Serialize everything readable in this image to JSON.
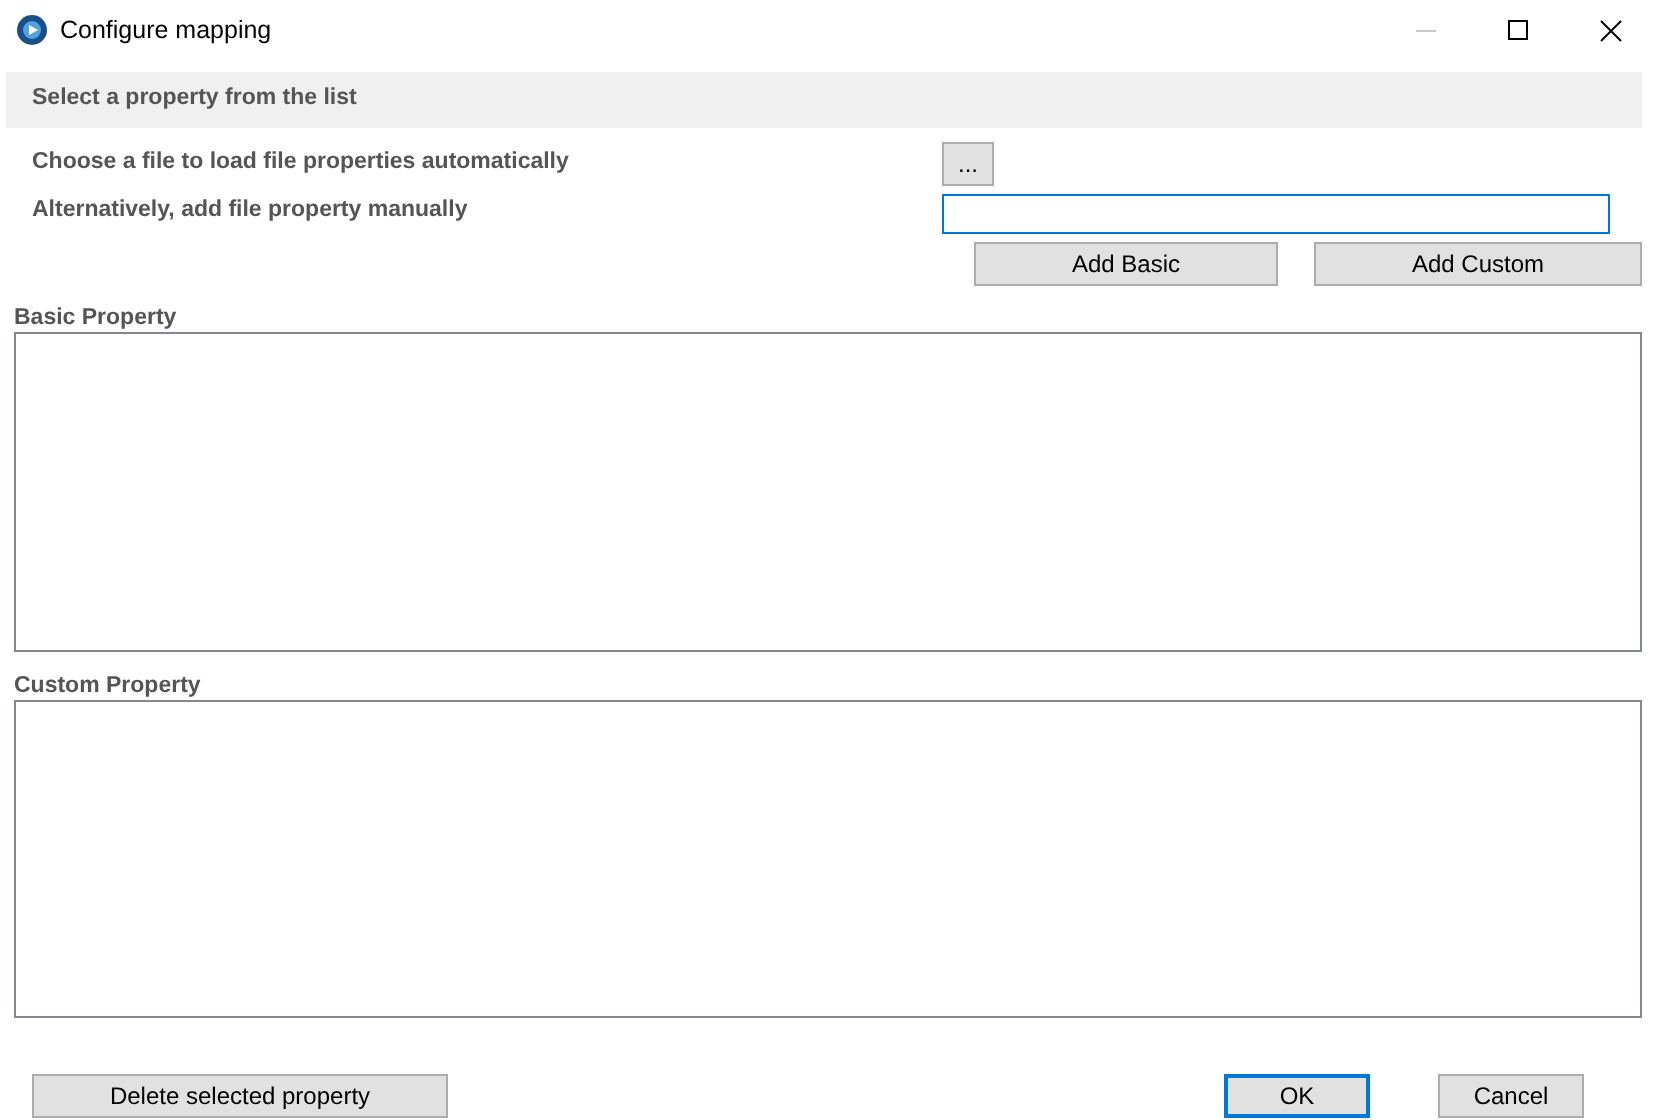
{
  "window": {
    "title": "Configure mapping",
    "controls": [
      {
        "kind": "minimize",
        "disabled": true
      },
      {
        "kind": "maximize",
        "disabled": false
      },
      {
        "kind": "close",
        "disabled": false
      }
    ]
  },
  "header": "Select a property from the list",
  "file_row": {
    "label": "Choose a file to load file properties automatically",
    "button": "..."
  },
  "manual_row": {
    "label": "Alternatively, add file property manually",
    "focused": true
  },
  "add_buttons": [
    "Add Basic",
    "Add Custom"
  ],
  "lists": [
    {
      "label": "Basic Property"
    },
    {
      "label": "Custom Property"
    }
  ],
  "footer": {
    "delete": "Delete selected property",
    "buttons": [
      {
        "label": "OK",
        "focused": true
      },
      {
        "label": "Cancel",
        "focused": false
      }
    ]
  }
}
